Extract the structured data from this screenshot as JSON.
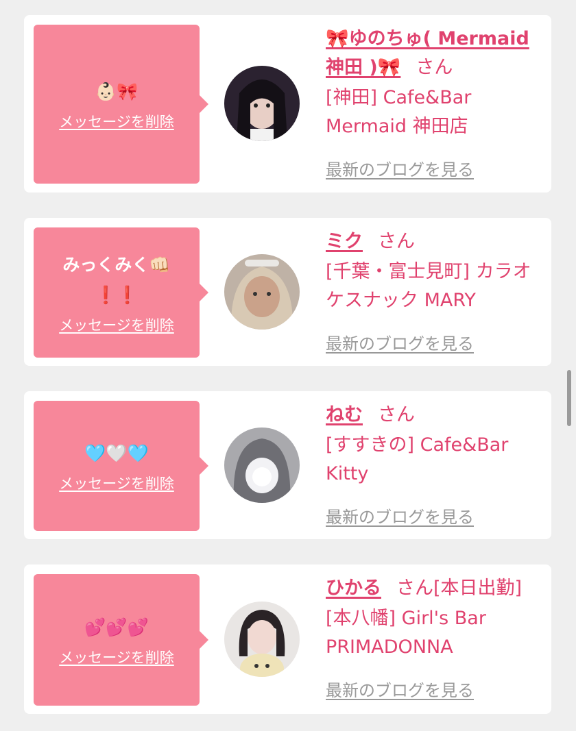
{
  "items": [
    {
      "message": "👶🏻🎀",
      "delete_label": "メッセージを削除",
      "name": "🎀ゆのちゅ( Mermaid 神田 )🎀",
      "suffix": "さん",
      "shop": "[神田] Cafe&Bar Mermaid 神田店",
      "blog_label": "最新のブログを見る"
    },
    {
      "message_line1": "みっくみく👊🏻",
      "message_line2": "❗️❗️",
      "delete_label": "メッセージを削除",
      "name": "ミク",
      "suffix": "さん",
      "shop": "[千葉・富士見町] カラオケスナック MARY",
      "blog_label": "最新のブログを見る"
    },
    {
      "message": "🩵🤍🩵",
      "delete_label": "メッセージを削除",
      "name": "ねむ",
      "suffix": "さん",
      "shop": "[すすきの] Cafe&Bar Kitty",
      "blog_label": "最新のブログを見る"
    },
    {
      "message": "💕💕💕",
      "delete_label": "メッセージを削除",
      "name": "ひかる",
      "suffix": "さん[本日出勤]",
      "shop": "[本八幡] Girl's Bar PRIMADONNA",
      "blog_label": "最新のブログを見る"
    }
  ],
  "colors": {
    "bubble": "#f7879a",
    "accent": "#e0426e",
    "muted": "#999999",
    "background": "#efefef"
  }
}
